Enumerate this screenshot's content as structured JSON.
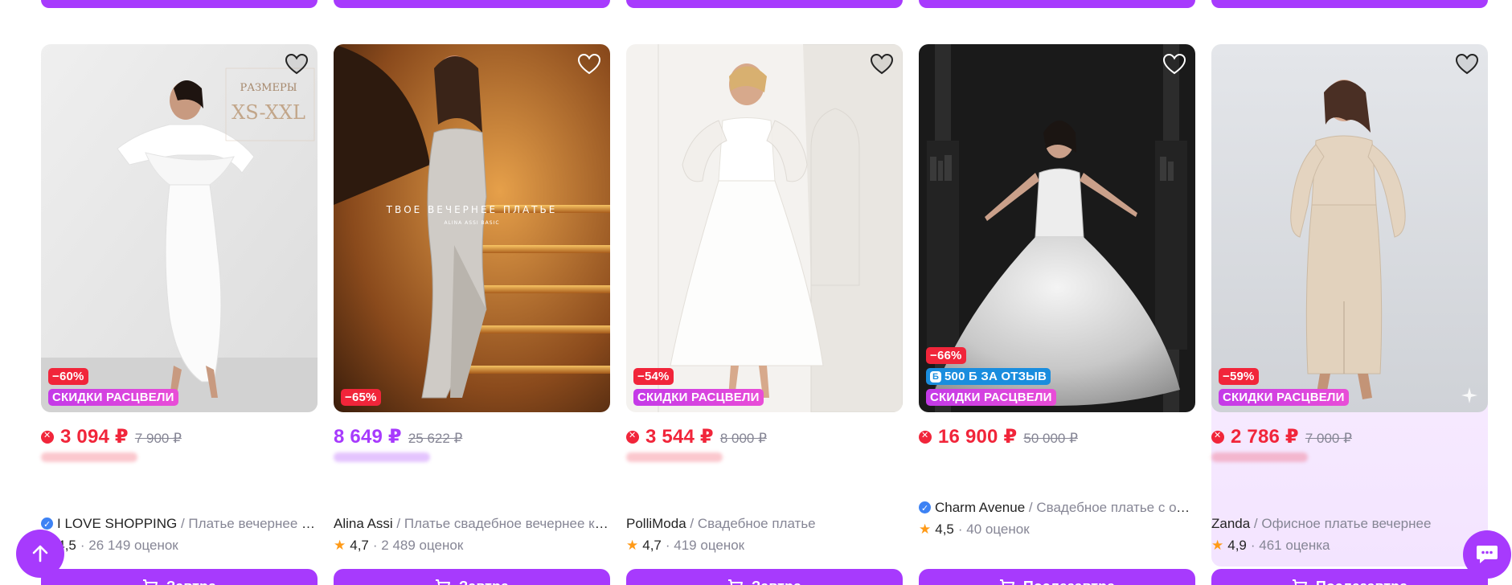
{
  "colors": {
    "accent": "#a73afd",
    "sale": "#f1253a",
    "muted": "#868695",
    "star": "#ff9a17"
  },
  "products": [
    {
      "photo_text_1": "РАЗМЕРЫ",
      "photo_text_2": "XS-XXL",
      "discount": "−60%",
      "promo": "СКИДКИ РАСЦВЕЛИ",
      "price": "3 094 ₽",
      "old_price": "7 900 ₽",
      "brand": "I LOVE SHOPPING",
      "name": " / Платье вечернее праздничное",
      "rating": "4,5",
      "reviews": "· 26 149 оценок",
      "delivery": "Завтра"
    },
    {
      "photo_text_1": "ТВОЕ ВЕЧЕРНЕЕ ПЛАТЬЕ",
      "photo_text_2": "ALINA ASSI BASIC",
      "discount": "−65%",
      "price": "8 649 ₽",
      "old_price": "25 622 ₽",
      "brand": "Alina Assi",
      "name": " / Платье свадебное вечернее корсетное",
      "rating": "4,7",
      "reviews": "· 2 489 оценок",
      "delivery": "Завтра"
    },
    {
      "discount": "−54%",
      "promo": "СКИДКИ РАСЦВЕЛИ",
      "price": "3 544 ₽",
      "old_price": "8 000 ₽",
      "brand": "PolliModa",
      "name": " / Свадебное платье",
      "rating": "4,7",
      "reviews": "· 419 оценок",
      "delivery": "Завтра"
    },
    {
      "discount": "−66%",
      "review_bonus": "500 Б ЗА ОТЗЫВ",
      "promo": "СКИДКИ РАСЦВЕЛИ",
      "price": "16 900 ₽",
      "old_price": "50 000 ₽",
      "brand": "Charm Avenue",
      "name": " / Свадебное платье с открытыми плечами",
      "rating": "4,5",
      "reviews": "· 40 оценок",
      "delivery": "Послезавтра"
    },
    {
      "discount": "−59%",
      "promo": "СКИДКИ РАСЦВЕЛИ",
      "price": "2 786 ₽",
      "old_price": "7 000 ₽",
      "brand": "Zanda",
      "name": " / Офисное платье вечернее",
      "rating": "4,9",
      "reviews": "· 461 оценка",
      "delivery": "Послезавтра"
    }
  ]
}
